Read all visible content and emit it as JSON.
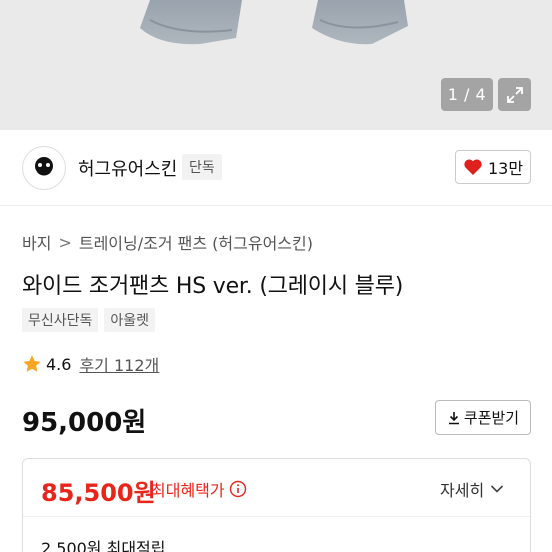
{
  "gallery": {
    "counter": "1 / 4"
  },
  "brand": {
    "name": "허그유어스킨",
    "tag": "단독",
    "likes": "13만"
  },
  "breadcrumb": {
    "items": [
      "바지",
      "트레이닝/조거 팬츠 (허그유어스킨)"
    ],
    "separator": ">"
  },
  "product": {
    "title": "와이드 조거팬츠 HS ver. (그레이시 블루)",
    "tags": [
      "무신사단독",
      "아울렛"
    ],
    "rating": "4.6",
    "reviews": "후기 112개",
    "price": "95,000원",
    "coupon_label": "쿠폰받기"
  },
  "benefit": {
    "price": "85,500원",
    "label": "최대혜택가",
    "detail_label": "자세히",
    "points": "2,500원 최대적립"
  },
  "colors": {
    "accent_red": "#e8251a",
    "heart": "#e0201b",
    "star": "#f5a623"
  }
}
